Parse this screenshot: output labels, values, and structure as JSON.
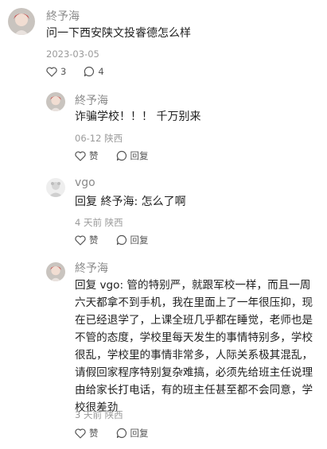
{
  "comments": [
    {
      "author": "終予海",
      "text": "问一下西安陕文投睿德怎么样",
      "date": "2023-03-05",
      "likes": "3",
      "replies": "4"
    },
    {
      "author": "終予海",
      "text": "诈骗学校！！！ 千万别来",
      "date": "06-12 陕西",
      "like_label": "赞",
      "reply_label": "回复"
    },
    {
      "author": "vgo",
      "text": "回复 終予海: 怎么了啊",
      "date": "4 天前 陕西",
      "like_label": "赞",
      "reply_label": "回复"
    },
    {
      "author": "終予海",
      "text": "回复 vgo: 管的特别严，就跟军校一样，而且一周六天都拿不到手机，我在里面上了一年很压抑，现在已经退学了，上课全班几乎都在睡觉，老师也是不管的态度，学校里每天发生的事情特别多，学校很乱，学校里的事情非常多，人际关系极其混乱，请假回家程序特别复杂难搞，必须先给班主任说理由给家长打电话，有的班主任甚至都不会同意，学校很差劲",
      "date": "3 天前 陕西",
      "like_label": "赞",
      "reply_label": "回复"
    }
  ]
}
